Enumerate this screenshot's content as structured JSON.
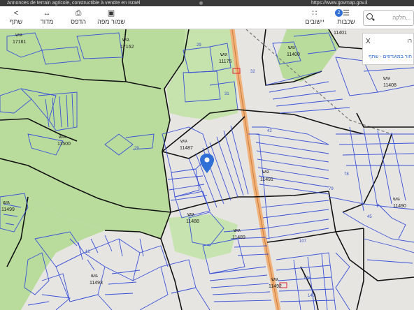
{
  "browser": {
    "ad_text": "Annonces de terrain agricole, constructible à vendre en Israël",
    "url": "https://www.govmap.gov.il"
  },
  "toolbar": {
    "share_label": "שתף",
    "measure_label": "מדוד",
    "print_label": "הדפס",
    "save_map_label": "שמור מפה",
    "settlements_label": "יישובים",
    "layers_label": "שכבות",
    "layers_count": "2",
    "search_placeholder": "...חלקה"
  },
  "panel": {
    "close_label": "X",
    "text": "רו",
    "link": "חור במועדפים - שתף"
  },
  "map": {
    "gush_word": "גוש",
    "blocks": [
      {
        "name": "17161"
      },
      {
        "name": "17162"
      },
      {
        "name": "11401"
      },
      {
        "name": "11400"
      },
      {
        "name": "11408"
      },
      {
        "name": "11175"
      },
      {
        "name": "11500"
      },
      {
        "name": "11487"
      },
      {
        "name": "11491"
      },
      {
        "name": "11499"
      },
      {
        "name": "11488"
      },
      {
        "name": "11489"
      },
      {
        "name": "11490"
      },
      {
        "name": "11493"
      },
      {
        "name": "11492"
      }
    ],
    "parcel_numbers": [
      "29",
      "32",
      "31",
      "42",
      "29",
      "79",
      "78",
      "107",
      "146",
      "145",
      "12",
      "45"
    ],
    "colors": {
      "forest": "#b9dc9c",
      "open_land": "#e7e5e1",
      "parcel_line": "#3a52d8",
      "block_line": "#111111",
      "road": "#f0b27a"
    }
  }
}
